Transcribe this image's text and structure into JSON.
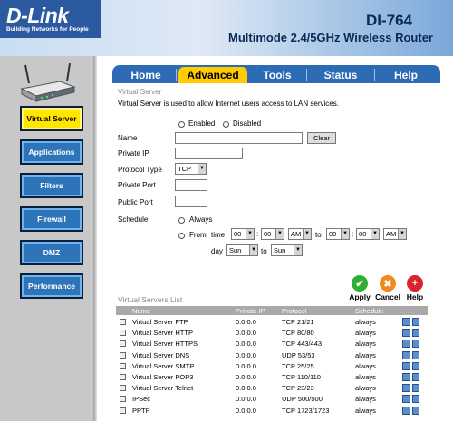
{
  "header": {
    "logo": "D-Link",
    "logo_tag": "Building Networks for People",
    "model": "DI-764",
    "subtitle": "Multimode 2.4/5GHz Wireless Router"
  },
  "sidebar": {
    "items": [
      {
        "label": "Virtual Server"
      },
      {
        "label": "Applications"
      },
      {
        "label": "Filters"
      },
      {
        "label": "Firewall"
      },
      {
        "label": "DMZ"
      },
      {
        "label": "Performance"
      }
    ],
    "active": "Virtual Server"
  },
  "tabs": [
    {
      "label": "Home"
    },
    {
      "label": "Advanced"
    },
    {
      "label": "Tools"
    },
    {
      "label": "Status"
    },
    {
      "label": "Help"
    }
  ],
  "form": {
    "section_title": "Virtual Server",
    "description": "Virtual Server is used to allow Internet users access to LAN services.",
    "enabled_label": "Enabled",
    "disabled_label": "Disabled",
    "name_label": "Name",
    "clear_label": "Clear",
    "private_ip_label": "Private IP",
    "protocol_label": "Protocol Type",
    "protocol_value": "TCP",
    "private_port_label": "Private Port",
    "public_port_label": "Public Port",
    "schedule_label": "Schedule",
    "always_label": "Always",
    "from_label": "From",
    "time_label": "time",
    "from_hour": "00",
    "from_min": "00",
    "from_ampm": "AM",
    "to_label": "to",
    "to_hour": "00",
    "to_min": "00",
    "to_ampm": "AM",
    "day_label": "day",
    "from_day": "Sun",
    "to_day_sep": "to",
    "to_day": "Sun"
  },
  "actions": {
    "apply": "Apply",
    "cancel": "Cancel",
    "help": "Help"
  },
  "list": {
    "title": "Virtual Servers List",
    "columns": [
      "Name",
      "Private IP",
      "Protocol",
      "Schedule"
    ],
    "rows": [
      {
        "name": "Virtual Server FTP",
        "ip": "0.0.0.0",
        "protocol": "TCP 21/21",
        "schedule": "always"
      },
      {
        "name": "Virtual Server HTTP",
        "ip": "0.0.0.0",
        "protocol": "TCP 80/80",
        "schedule": "always"
      },
      {
        "name": "Virtual Server HTTPS",
        "ip": "0.0.0.0",
        "protocol": "TCP 443/443",
        "schedule": "always"
      },
      {
        "name": "Virtual Server DNS",
        "ip": "0.0.0.0",
        "protocol": "UDP 53/53",
        "schedule": "always"
      },
      {
        "name": "Virtual Server SMTP",
        "ip": "0.0.0.0",
        "protocol": "TCP 25/25",
        "schedule": "always"
      },
      {
        "name": "Virtual Server POP3",
        "ip": "0.0.0.0",
        "protocol": "TCP 110/110",
        "schedule": "always"
      },
      {
        "name": "Virtual Server Telnet",
        "ip": "0.0.0.0",
        "protocol": "TCP 23/23",
        "schedule": "always"
      },
      {
        "name": "IPSec",
        "ip": "0.0.0.0",
        "protocol": "UDP 500/500",
        "schedule": "always"
      },
      {
        "name": "PPTP",
        "ip": "0.0.0.0",
        "protocol": "TCP 1723/1723",
        "schedule": "always"
      }
    ]
  },
  "colors": {
    "accent": "#2e6bb5",
    "active_tab": "#ffcc00",
    "active_nav": "#ffe500",
    "apply": "#2fae2f",
    "cancel": "#f08a1c",
    "help": "#d9232d"
  }
}
